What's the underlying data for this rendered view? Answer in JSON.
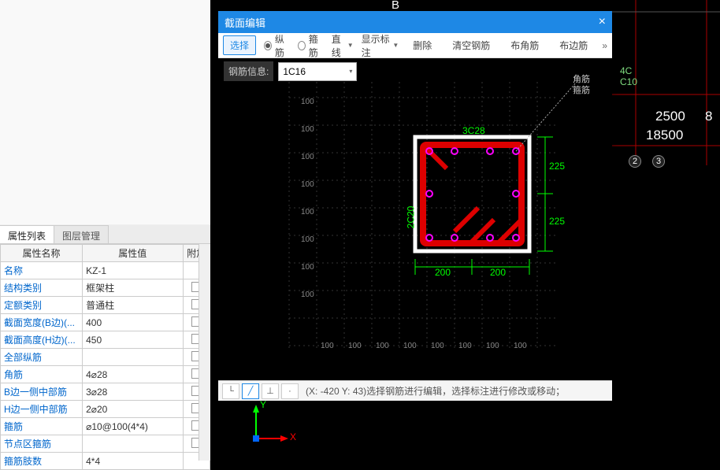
{
  "dialog": {
    "title": "截面编辑",
    "toolbar": {
      "select": "选择",
      "radio_zong": "纵筋",
      "radio_gu": "箍筋",
      "line_dd": "直线",
      "show_label": "显示标注",
      "delete": "删除",
      "clear": "清空钢筋",
      "corner": "布角筋",
      "edge": "布边筋"
    },
    "steel_info_label": "钢筋信息:",
    "steel_info_value": "1C16",
    "status_text": "(X: -420 Y: 43)选择钢筋进行编辑，选择标注进行修改或移动；",
    "corner_label_1": "角筋",
    "corner_label_2": "箍筋",
    "top_label": "3C28",
    "left_label": "2C20",
    "dim_225a": "225",
    "dim_225b": "225",
    "dim_200a": "200",
    "dim_200b": "200",
    "grid_100": "100"
  },
  "panel": {
    "tabs": {
      "prop": "属性列表",
      "layer": "图层管理"
    },
    "headers": {
      "name": "属性名称",
      "value": "属性值",
      "extra": "附加"
    },
    "rows": [
      {
        "k": "名称",
        "v": "KZ-1"
      },
      {
        "k": "结构类别",
        "v": "框架柱"
      },
      {
        "k": "定额类别",
        "v": "普通柱"
      },
      {
        "k": "截面宽度(B边)(...",
        "v": "400"
      },
      {
        "k": "截面高度(H边)(...",
        "v": "450"
      },
      {
        "k": "全部纵筋",
        "v": ""
      },
      {
        "k": "角筋",
        "v": "4⌀28"
      },
      {
        "k": "B边一侧中部筋",
        "v": "3⌀28"
      },
      {
        "k": "H边一侧中部筋",
        "v": "2⌀20"
      },
      {
        "k": "箍筋",
        "v": "⌀10@100(4*4)"
      },
      {
        "k": "节点区箍筋",
        "v": ""
      },
      {
        "k": "箍筋肢数",
        "v": "4*4"
      }
    ]
  },
  "cad": {
    "top_b": "B",
    "label_4c": "4C",
    "label_c10": "C10",
    "dim_2500": "2500",
    "dim_18500": "18500",
    "dim_8": "8",
    "node2": "2",
    "node3": "3"
  },
  "axis": {
    "x": "X",
    "y": "Y"
  },
  "chart_data": {
    "type": "diagram",
    "section": {
      "width_mm": 400,
      "height_mm": 450,
      "top_bars": "3C28",
      "side_bars": "2C20",
      "corner_bars": "角筋",
      "stirrup": "箍筋",
      "dims_horizontal": [
        200,
        200
      ],
      "dims_vertical": [
        225,
        225
      ],
      "grid_spacing": 100
    }
  }
}
